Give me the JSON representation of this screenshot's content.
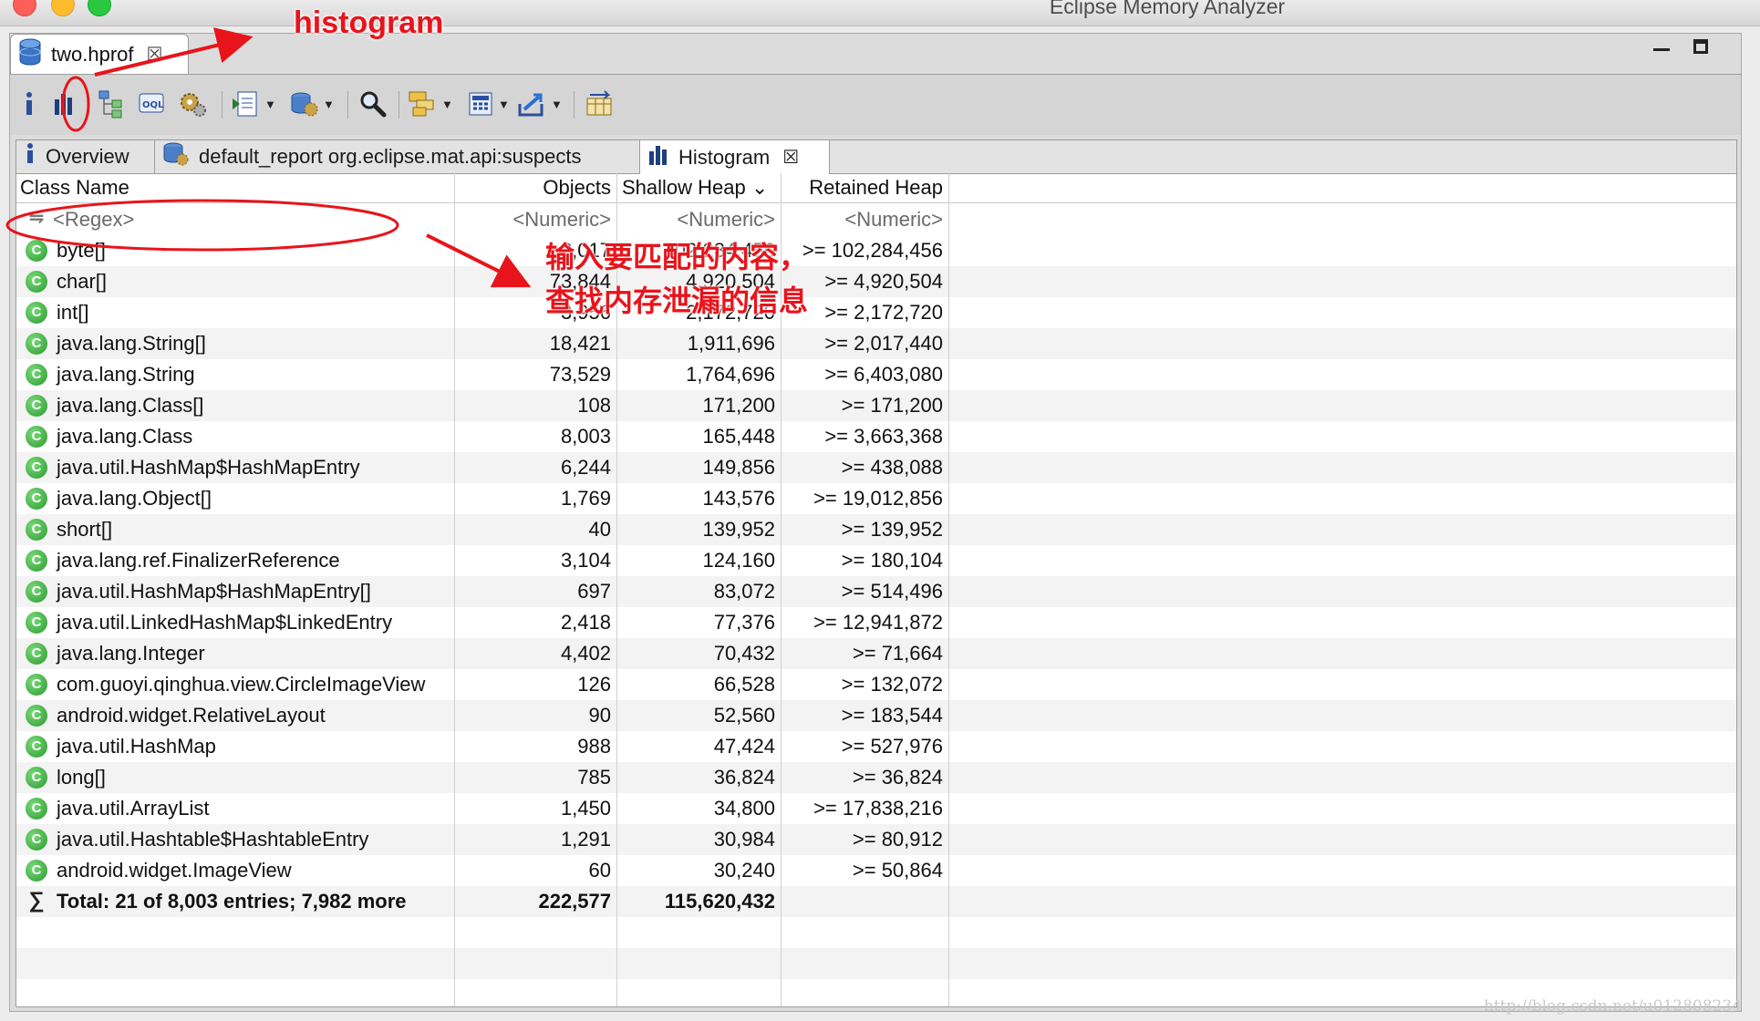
{
  "window": {
    "title": "Eclipse Memory Analyzer"
  },
  "editor_tab": {
    "label": "two.hprof",
    "close": "☒"
  },
  "annotations": {
    "histogram": "histogram",
    "note": "输入要匹配的内容，查找内存泄漏的信息"
  },
  "tabs": [
    {
      "label": "Overview",
      "close": ""
    },
    {
      "label": "default_report  org.eclipse.mat.api:suspects",
      "close": ""
    },
    {
      "label": "Histogram",
      "close": "☒"
    }
  ],
  "columns": {
    "class_name": "Class Name",
    "objects": "Objects",
    "shallow_heap": "Shallow Heap",
    "sort_indicator": "⌄",
    "retained_heap": "Retained Heap"
  },
  "filter_row": {
    "class_name": "<Regex>",
    "objects": "<Numeric>",
    "shallow_heap": "<Numeric>",
    "retained_heap": "<Numeric>"
  },
  "rows": [
    {
      "name": "byte[]",
      "objects": "8,017",
      "shallow": "102,284,456",
      "retained": ">= 102,284,456"
    },
    {
      "name": "char[]",
      "objects": "73,844",
      "shallow": "4,920,504",
      "retained": ">= 4,920,504"
    },
    {
      "name": "int[]",
      "objects": "3,956",
      "shallow": "2,172,720",
      "retained": ">= 2,172,720"
    },
    {
      "name": "java.lang.String[]",
      "objects": "18,421",
      "shallow": "1,911,696",
      "retained": ">= 2,017,440"
    },
    {
      "name": "java.lang.String",
      "objects": "73,529",
      "shallow": "1,764,696",
      "retained": ">= 6,403,080"
    },
    {
      "name": "java.lang.Class[]",
      "objects": "108",
      "shallow": "171,200",
      "retained": ">= 171,200"
    },
    {
      "name": "java.lang.Class",
      "objects": "8,003",
      "shallow": "165,448",
      "retained": ">= 3,663,368"
    },
    {
      "name": "java.util.HashMap$HashMapEntry",
      "objects": "6,244",
      "shallow": "149,856",
      "retained": ">= 438,088"
    },
    {
      "name": "java.lang.Object[]",
      "objects": "1,769",
      "shallow": "143,576",
      "retained": ">= 19,012,856"
    },
    {
      "name": "short[]",
      "objects": "40",
      "shallow": "139,952",
      "retained": ">= 139,952"
    },
    {
      "name": "java.lang.ref.FinalizerReference",
      "objects": "3,104",
      "shallow": "124,160",
      "retained": ">= 180,104"
    },
    {
      "name": "java.util.HashMap$HashMapEntry[]",
      "objects": "697",
      "shallow": "83,072",
      "retained": ">= 514,496"
    },
    {
      "name": "java.util.LinkedHashMap$LinkedEntry",
      "objects": "2,418",
      "shallow": "77,376",
      "retained": ">= 12,941,872"
    },
    {
      "name": "java.lang.Integer",
      "objects": "4,402",
      "shallow": "70,432",
      "retained": ">= 71,664"
    },
    {
      "name": "com.guoyi.qinghua.view.CircleImageView",
      "objects": "126",
      "shallow": "66,528",
      "retained": ">= 132,072"
    },
    {
      "name": "android.widget.RelativeLayout",
      "objects": "90",
      "shallow": "52,560",
      "retained": ">= 183,544"
    },
    {
      "name": "java.util.HashMap",
      "objects": "988",
      "shallow": "47,424",
      "retained": ">= 527,976"
    },
    {
      "name": "long[]",
      "objects": "785",
      "shallow": "36,824",
      "retained": ">= 36,824"
    },
    {
      "name": "java.util.ArrayList",
      "objects": "1,450",
      "shallow": "34,800",
      "retained": ">= 17,838,216"
    },
    {
      "name": "java.util.Hashtable$HashtableEntry",
      "objects": "1,291",
      "shallow": "30,984",
      "retained": ">= 80,912"
    },
    {
      "name": "android.widget.ImageView",
      "objects": "60",
      "shallow": "30,240",
      "retained": ">= 50,864"
    }
  ],
  "total_row": {
    "label": "Total: 21 of 8,003 entries; 7,982 more",
    "objects": "222,577",
    "shallow": "115,620,432",
    "retained": ""
  },
  "watermark": "http://blog.csdn.net/u012808234",
  "colors": {
    "annotation_red": "#e8141b",
    "class_icon_green": "#2b9a2e",
    "toolbar_bg": "#d5d5d5"
  }
}
